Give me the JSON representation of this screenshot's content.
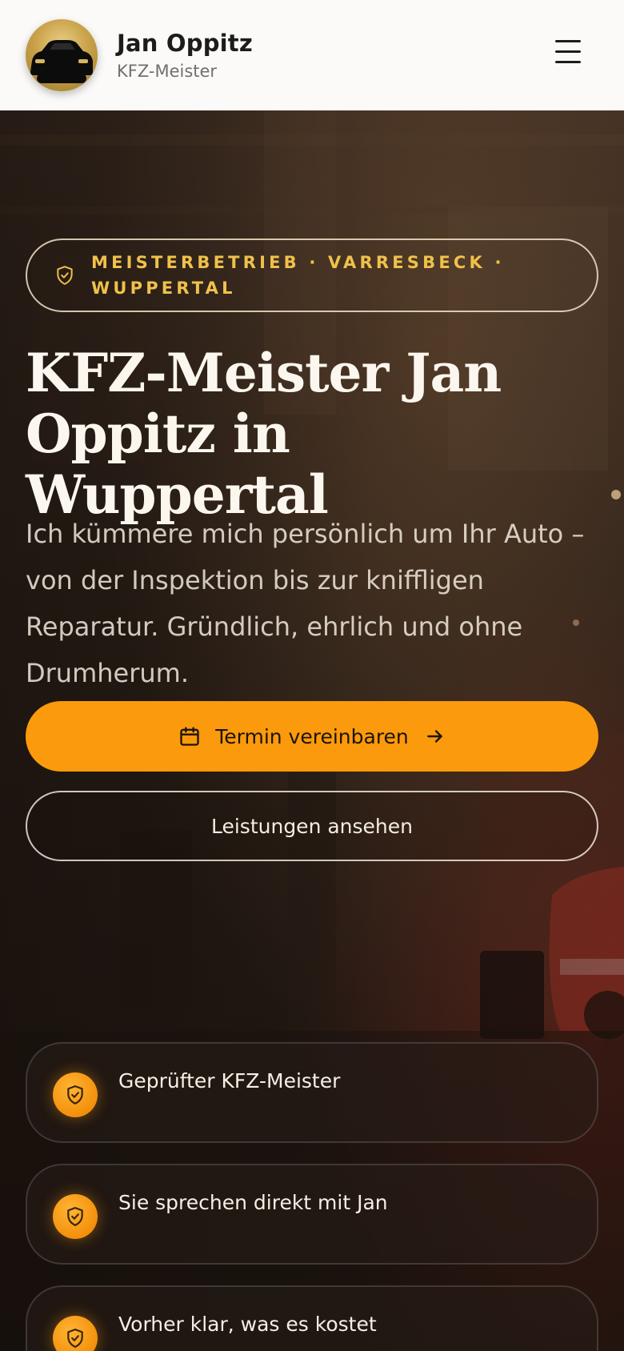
{
  "header": {
    "name": "Jan Oppitz",
    "subtitle": "KFZ-Meister",
    "avatar_icon": "car-icon",
    "menu_icon": "hamburger-menu-icon"
  },
  "hero": {
    "badge": "MEISTERBETRIEB · VARRESBECK · WUPPERTAL",
    "badge_icon": "shield-check-icon",
    "title": "KFZ-Meister Jan Oppitz in Wuppertal",
    "lead": "Ich kümmere mich persönlich um Ihr Auto – von der Inspektion bis zur kniffligen Reparatur. Gründlich, ehrlich und ohne Drumherum.",
    "primary_button": "Termin vereinbaren",
    "primary_button_icon": "calendar-icon",
    "primary_button_arrow": "arrow-right-icon",
    "secondary_button": "Leistungen ansehen"
  },
  "features": [
    {
      "label": "Geprüfter KFZ-Meister",
      "icon": "shield-check-icon"
    },
    {
      "label": "Sie sprechen direkt mit Jan",
      "icon": "shield-check-icon"
    },
    {
      "label": "Vorher klar, was es kostet",
      "icon": "shield-check-icon"
    }
  ],
  "colors": {
    "accent": "#fb9a0d",
    "badge_text": "#f0c14a",
    "header_bg": "#fbfaf8",
    "hero_text": "#fbf7ef"
  }
}
